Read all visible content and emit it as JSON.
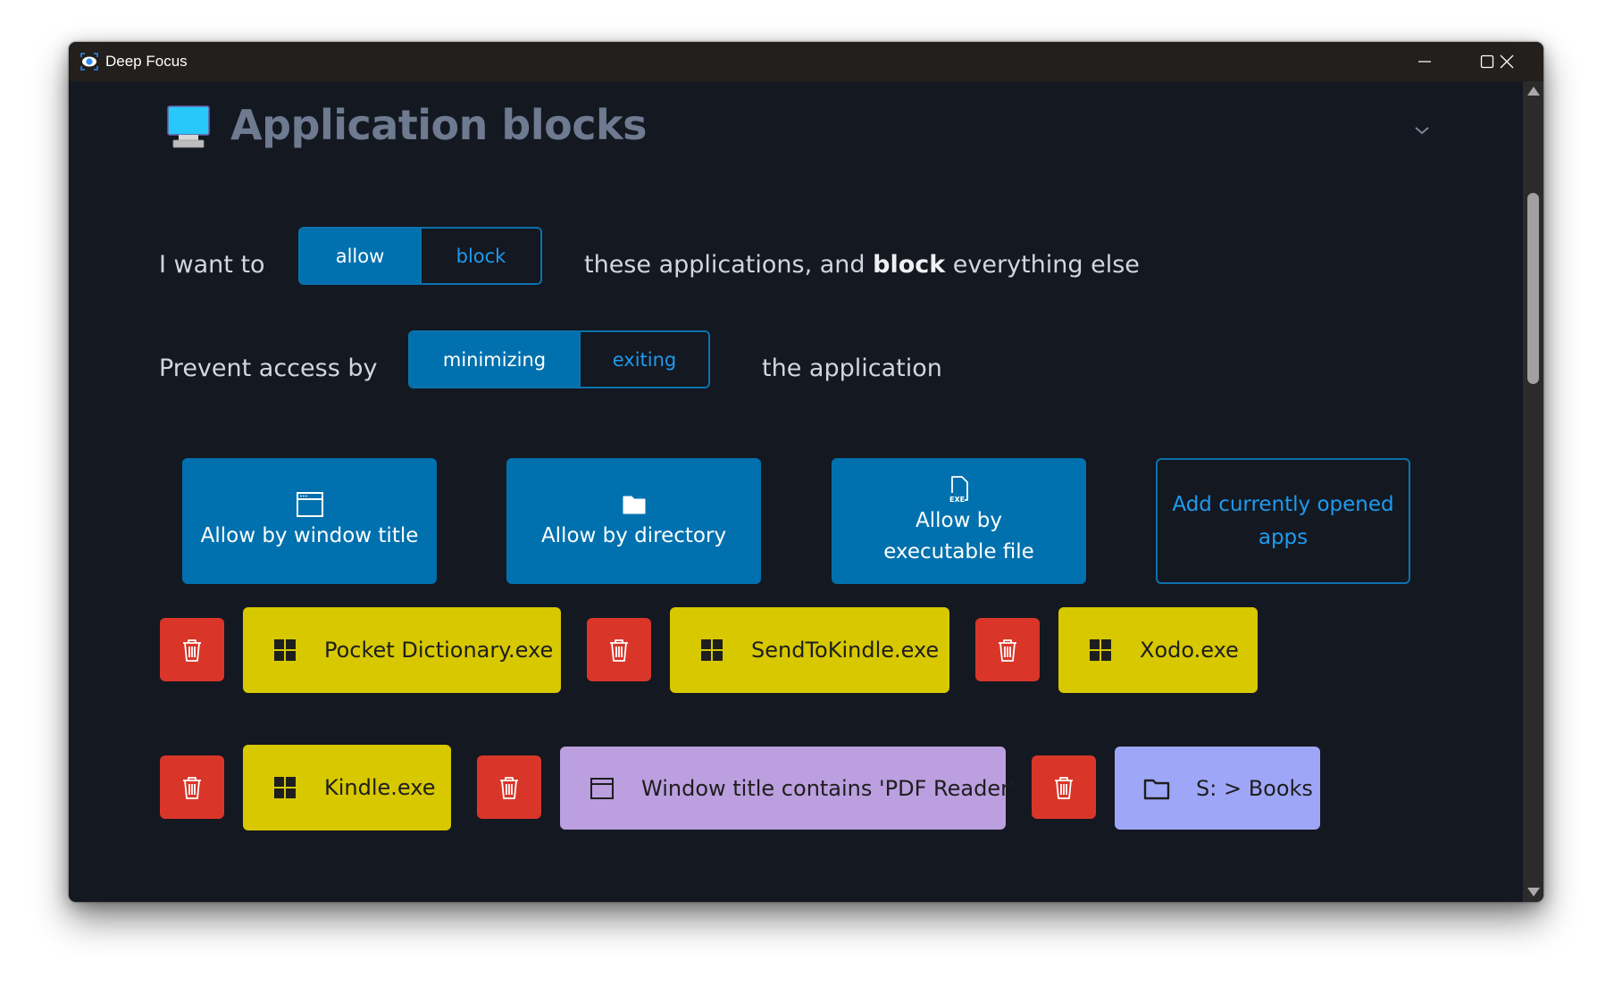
{
  "window": {
    "title": "Deep Focus",
    "controls": {
      "minimize": "minimize",
      "maximize": "maximize",
      "close": "close"
    }
  },
  "section": {
    "title": "Application blocks",
    "icon": "desktop-computer-icon",
    "expanded": true
  },
  "mode_row": {
    "prefix": "I want to",
    "options": [
      "allow",
      "block"
    ],
    "selected": "allow",
    "suffix_start": "these applications, and ",
    "suffix_bold": "block",
    "suffix_end": " everything else"
  },
  "prevent_row": {
    "prefix": "Prevent access by",
    "options": [
      "minimizing",
      "exiting"
    ],
    "selected": "minimizing",
    "suffix": "the application"
  },
  "actions": [
    {
      "label": "Allow by window title",
      "icon": "window-icon"
    },
    {
      "label": "Allow by directory",
      "icon": "folder-icon"
    },
    {
      "label": "Allow by executable file",
      "icon": "exe-file-icon"
    },
    {
      "label": "Add currently opened apps",
      "icon": ""
    }
  ],
  "rules": [
    {
      "type": "executable",
      "label": "Pocket Dictionary.exe",
      "icon": "windows-logo-icon"
    },
    {
      "type": "executable",
      "label": "SendToKindle.exe",
      "icon": "windows-logo-icon"
    },
    {
      "type": "executable",
      "label": "Xodo.exe",
      "icon": "windows-logo-icon"
    },
    {
      "type": "executable",
      "label": "Kindle.exe",
      "icon": "windows-logo-icon"
    },
    {
      "type": "window_title",
      "label": "Window title contains 'PDF Reader'",
      "icon": "window-icon"
    },
    {
      "type": "directory",
      "label": "S: > Books",
      "icon": "folder-icon"
    }
  ],
  "colors": {
    "background": "#141821",
    "titlebar": "#221f1d",
    "accent": "#0071ae",
    "accent_text": "#1d9bf0",
    "delete": "#d93629",
    "executable_chip": "#d7c800",
    "window_title_chip": "#bb9fdf",
    "directory_chip": "#9ea7f7",
    "heading": "#6e7a8f"
  }
}
